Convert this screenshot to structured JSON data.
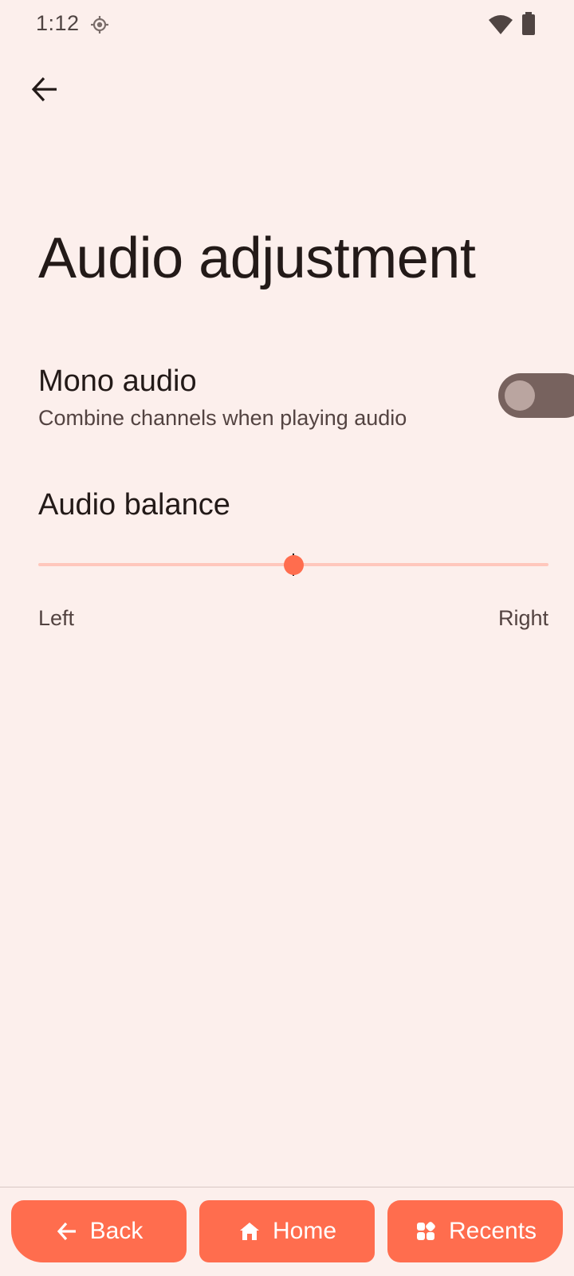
{
  "status_bar": {
    "time": "1:12",
    "location_icon": "location-target-icon",
    "wifi_icon": "wifi-icon",
    "battery_icon": "battery-icon"
  },
  "header": {
    "back_icon": "arrow-back-icon",
    "title": "Audio adjustment"
  },
  "mono_audio": {
    "title": "Mono audio",
    "subtitle": "Combine channels when playing audio",
    "enabled": false
  },
  "audio_balance": {
    "title": "Audio balance",
    "left_label": "Left",
    "right_label": "Right",
    "value_fraction": 0.5
  },
  "nav": {
    "back_label": "Back",
    "home_label": "Home",
    "recents_label": "Recents"
  },
  "colors": {
    "background": "#fcefec",
    "accent": "#ff6d4e",
    "toggle_track_off": "#77625e",
    "toggle_thumb_off": "#baa5a0",
    "slider_track": "#ffc7bc",
    "text_primary": "#231a18",
    "text_secondary": "#534341"
  }
}
